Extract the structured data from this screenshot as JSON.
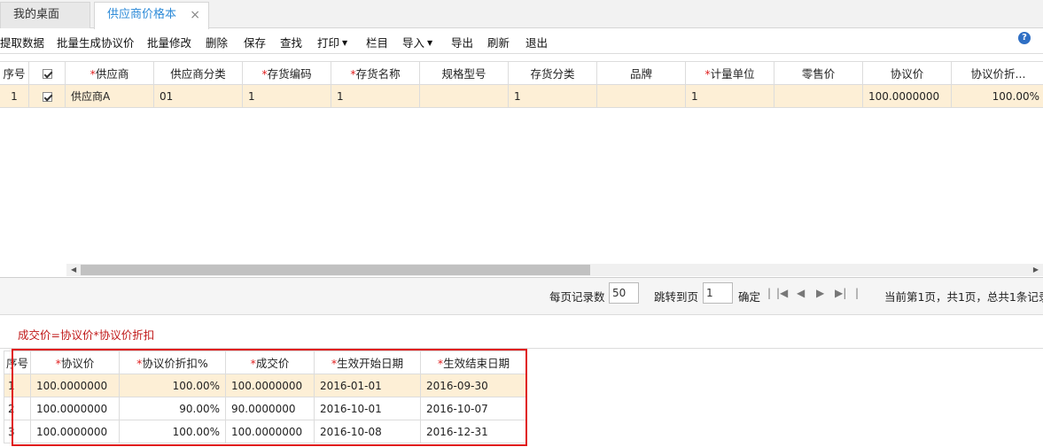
{
  "tabs": [
    {
      "label": "我的桌面",
      "active": false
    },
    {
      "label": "供应商价格本",
      "active": true
    }
  ],
  "tab_close_glyph": "×",
  "toolbar": {
    "items": [
      "提取数据",
      "批量生成协议价",
      "批量修改",
      "删除",
      "保存",
      "查找",
      "打印",
      "栏目",
      "导入",
      "导出",
      "刷新",
      "退出"
    ],
    "help_glyph": "?"
  },
  "main_grid": {
    "columns": [
      "序号",
      "",
      "供应商",
      "供应商分类",
      "存货编码",
      "存货名称",
      "规格型号",
      "存货分类",
      "品牌",
      "计量单位",
      "零售价",
      "协议价",
      "协议价折..."
    ],
    "required_mark": "*",
    "rows": [
      {
        "seq": "1",
        "checked": true,
        "supplier": "供应商A",
        "supplier_class": "01",
        "inv_code": "1",
        "inv_name": "1",
        "spec": "",
        "inv_class": "1",
        "brand": "",
        "unit": "1",
        "retail": "",
        "price": "100.0000000",
        "discount": "100.00%"
      }
    ]
  },
  "pager": {
    "per_page_label": "每页记录数",
    "per_page_value": "50",
    "goto_label": "跳转到页",
    "goto_value": "1",
    "confirm_label": "确定",
    "status": "当前第1页，共1页，总共1条记录"
  },
  "formula": "成交价=协议价*协议价折扣",
  "detail_grid": {
    "columns": [
      "序号",
      "协议价",
      "协议价折扣%",
      "成交价",
      "生效开始日期",
      "生效结束日期"
    ],
    "rows": [
      {
        "seq": "1",
        "price": "100.0000000",
        "discount": "100.00%",
        "deal": "100.0000000",
        "start": "2016-01-01",
        "end": "2016-09-30"
      },
      {
        "seq": "2",
        "price": "100.0000000",
        "discount": "90.00%",
        "deal": "90.0000000",
        "start": "2016-10-01",
        "end": "2016-10-07"
      },
      {
        "seq": "3",
        "price": "100.0000000",
        "discount": "100.00%",
        "deal": "100.0000000",
        "start": "2016-10-08",
        "end": "2016-12-31"
      }
    ]
  },
  "colors": {
    "accent": "#2e8bd8",
    "selected_row": "#fdefd6",
    "required": "#e02020",
    "highlight_box": "#e01818"
  }
}
